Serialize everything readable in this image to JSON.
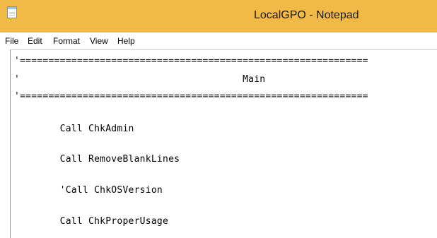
{
  "window": {
    "title": "LocalGPO - Notepad",
    "icon": "notepad-icon",
    "titlebar_color": "#f1b945"
  },
  "menu": {
    "items": [
      "File",
      "Edit",
      "Format",
      "View",
      "Help"
    ]
  },
  "editor": {
    "lines": [
      "'=============================================================",
      "'                                       Main",
      "'=============================================================",
      "        Call ChkAdmin",
      "        Call RemoveBlankLines",
      "        'Call ChkOSVersion",
      "        Call ChkProperUsage"
    ]
  }
}
